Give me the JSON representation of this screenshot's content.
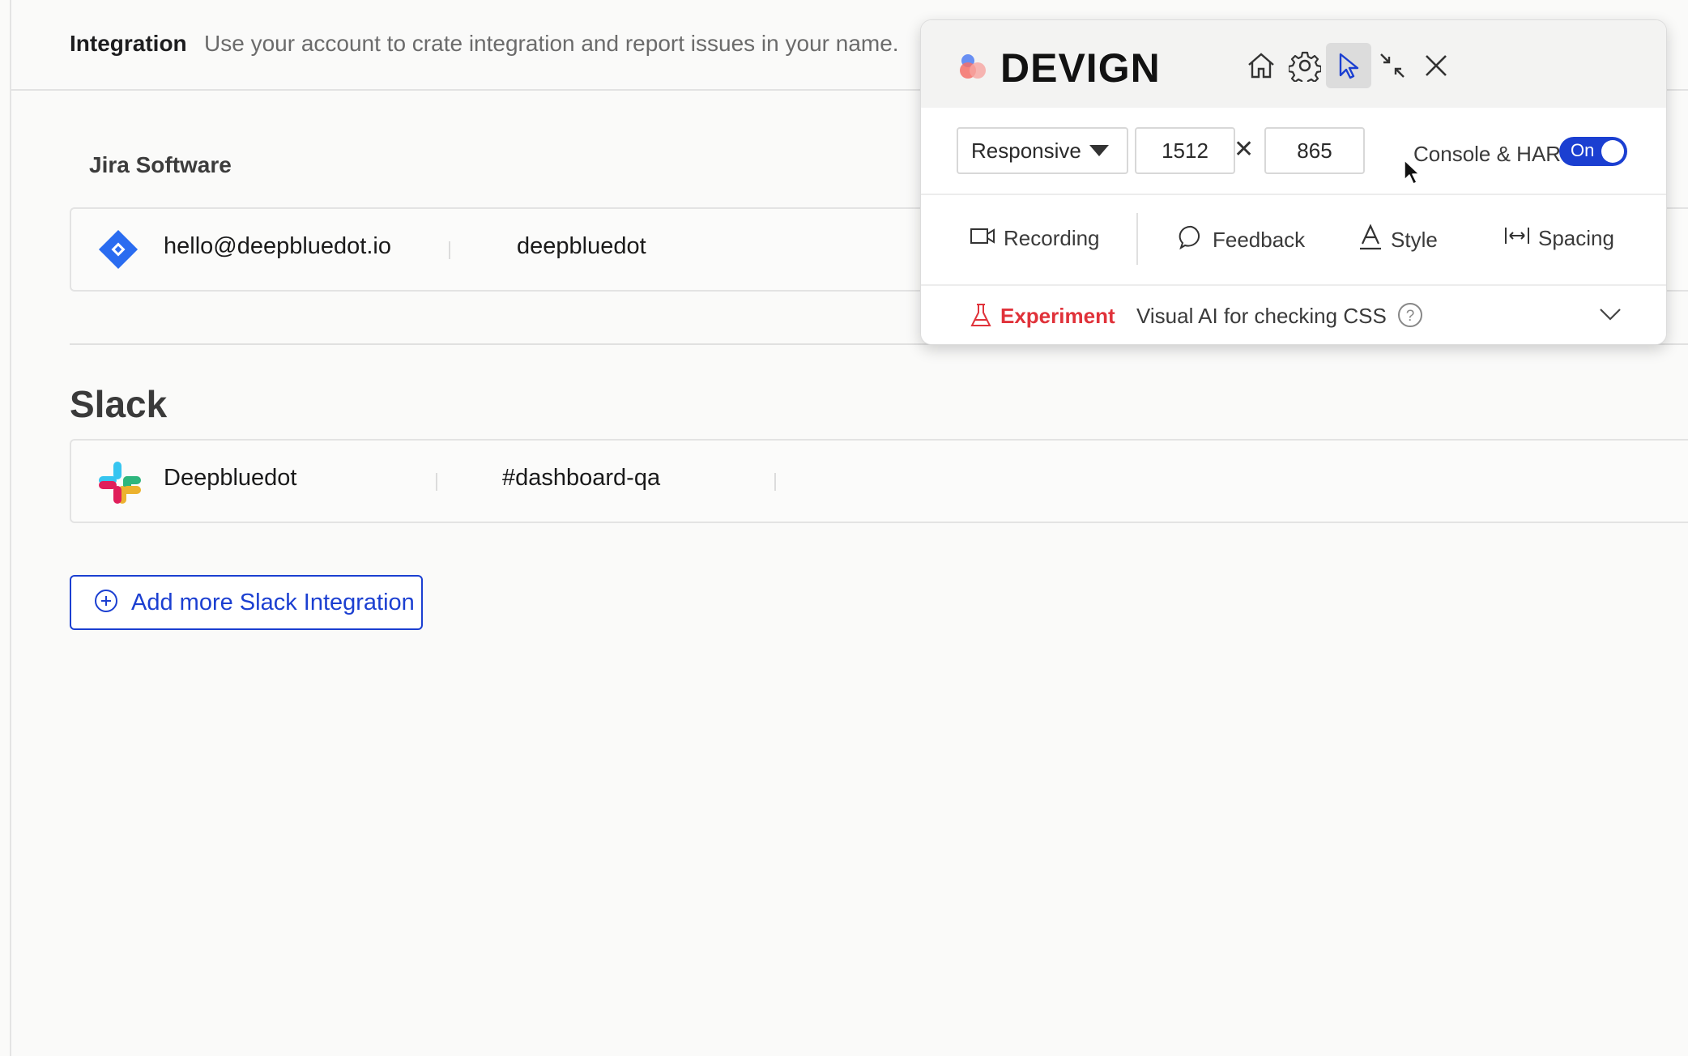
{
  "page": {
    "title": "Integration",
    "subtitle": "Use your account to crate integration and report issues in your name."
  },
  "jira": {
    "heading": "Jira Software",
    "email": "hello@deepbluedot.io",
    "workspace": "deepbluedot"
  },
  "slack": {
    "heading": "Slack",
    "workspace": "Deepbluedot",
    "channel": "#dashboard-qa",
    "add_button": "Add more Slack Integration"
  },
  "devign": {
    "brand": "DEVIGN",
    "header_icons": [
      "home-icon",
      "gear-icon",
      "pointer-icon",
      "collapse-icon",
      "close-icon"
    ],
    "viewport_mode": "Responsive",
    "width": "1512",
    "height": "865",
    "console_har_label": "Console & HAR",
    "console_har_toggle": "On",
    "tools": {
      "recording": "Recording",
      "feedback": "Feedback",
      "style": "Style",
      "spacing": "Spacing"
    },
    "experiment_label": "Experiment",
    "experiment_desc": "Visual AI for checking CSS"
  },
  "colors": {
    "accent": "#1b3fd1",
    "experiment": "#e0323a"
  }
}
